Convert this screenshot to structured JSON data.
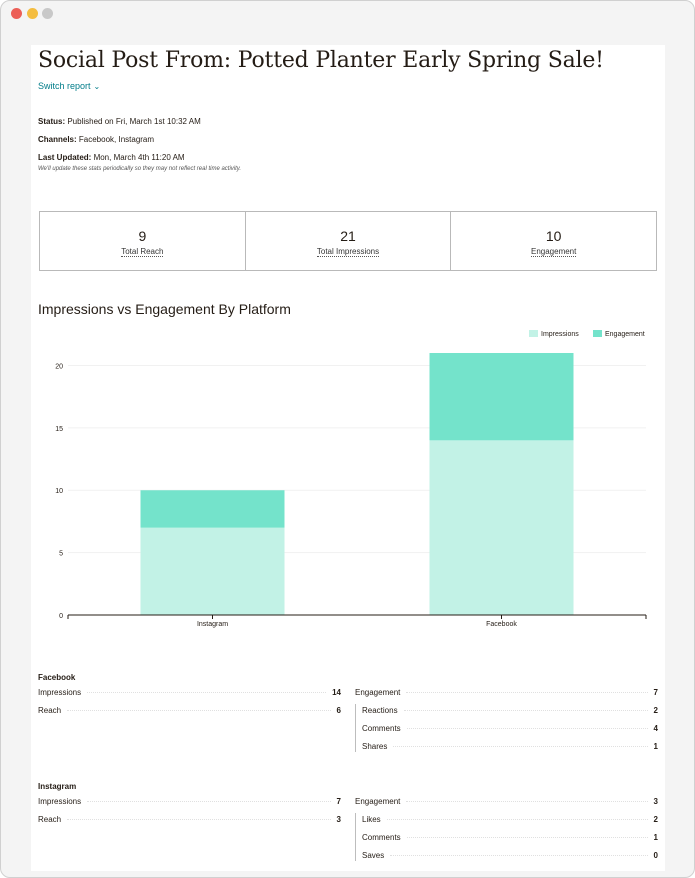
{
  "window": {
    "controls": [
      "close-dot",
      "minimize-dot",
      "zoom-dot"
    ]
  },
  "header": {
    "title": "Social Post From: Potted Planter Early Spring Sale!",
    "switch_report": "Switch report",
    "switch_icon": "chevron-down-icon"
  },
  "meta": {
    "status_label": "Status:",
    "status_value": " Published on Fri, March 1st 10:32 AM",
    "channels_label": "Channels:",
    "channels_value": " Facebook, Instagram",
    "updated_label": "Last Updated:",
    "updated_value": " Mon, March 4th 11:20 AM",
    "note": "We'll update these stats periodically so they may not reflect real time activity."
  },
  "stats": [
    {
      "value": "9",
      "label": "Total Reach"
    },
    {
      "value": "21",
      "label": "Total Impressions"
    },
    {
      "value": "10",
      "label": "Engagement"
    }
  ],
  "chart_title": "Impressions vs Engagement By Platform",
  "chart_data": {
    "type": "bar",
    "stacked": true,
    "categories": [
      "Instagram",
      "Facebook"
    ],
    "series": [
      {
        "name": "Impressions",
        "values": [
          7,
          14
        ],
        "color": "#c2f2e6"
      },
      {
        "name": "Engagement",
        "values": [
          3,
          7
        ],
        "color": "#74e3cb"
      }
    ],
    "yticks": [
      "0",
      "5",
      "10",
      "15",
      "20"
    ],
    "ylim": [
      0,
      21
    ],
    "legend": "top-right",
    "grid": true
  },
  "facebook": {
    "title": "Facebook",
    "left": [
      {
        "label": "Impressions",
        "value": "14"
      },
      {
        "label": "Reach",
        "value": "6"
      }
    ],
    "right_head": {
      "label": "Engagement",
      "value": "7"
    },
    "right": [
      {
        "label": "Reactions",
        "value": "2"
      },
      {
        "label": "Comments",
        "value": "4"
      },
      {
        "label": "Shares",
        "value": "1"
      }
    ]
  },
  "instagram": {
    "title": "Instagram",
    "left": [
      {
        "label": "Impressions",
        "value": "7"
      },
      {
        "label": "Reach",
        "value": "3"
      }
    ],
    "right_head": {
      "label": "Engagement",
      "value": "3"
    },
    "right": [
      {
        "label": "Likes",
        "value": "2"
      },
      {
        "label": "Comments",
        "value": "1"
      },
      {
        "label": "Saves",
        "value": "0"
      }
    ]
  }
}
